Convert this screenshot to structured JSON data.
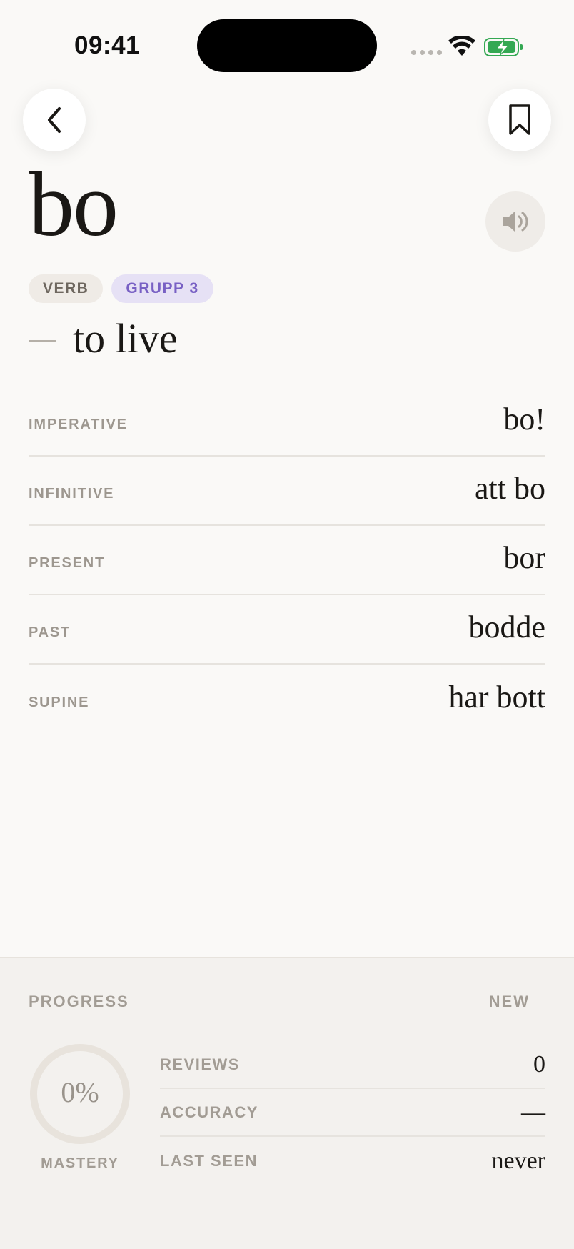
{
  "status_bar": {
    "time": "09:41",
    "signal_icon": "cellular-signal-icon",
    "wifi_icon": "wifi-icon",
    "battery_icon": "battery-charging-icon",
    "battery_color": "#34a853"
  },
  "nav": {
    "back_icon": "chevron-left-icon",
    "bookmark_icon": "bookmark-icon"
  },
  "entry": {
    "word": "bo",
    "audio_icon": "speaker-icon",
    "tags": [
      "VERB",
      "GRUPP 3"
    ],
    "translation": "to live"
  },
  "forms": [
    {
      "label": "IMPERATIVE",
      "value": "bo!"
    },
    {
      "label": "INFINITIVE",
      "value": "att bo"
    },
    {
      "label": "PRESENT",
      "value": "bor"
    },
    {
      "label": "PAST",
      "value": "bodde"
    },
    {
      "label": "SUPINE",
      "value": "har bott"
    }
  ],
  "progress": {
    "title": "PROGRESS",
    "status": "NEW",
    "mastery_percent_text": "0%",
    "mastery_fraction": 0,
    "mastery_label": "MASTERY",
    "stats": [
      {
        "label": "REVIEWS",
        "value": "0"
      },
      {
        "label": "ACCURACY",
        "value": "—"
      },
      {
        "label": "LAST SEEN",
        "value": "never"
      }
    ]
  },
  "colors": {
    "accent_purple": "#7860c4",
    "background": "#faf9f7",
    "panel_background": "#f3f1ee"
  }
}
